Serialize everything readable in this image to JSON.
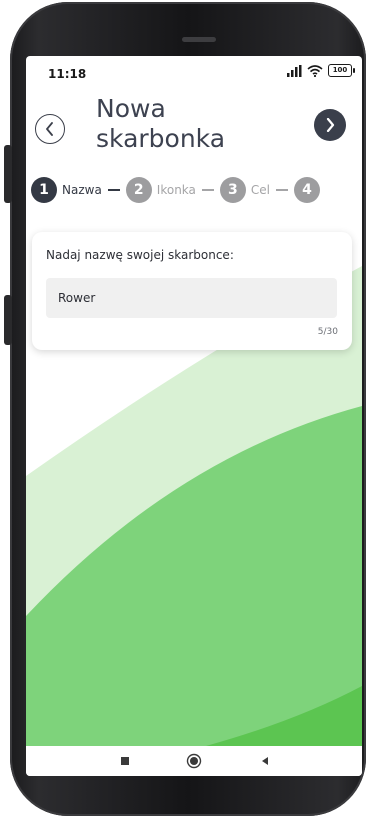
{
  "status": {
    "time": "11:18",
    "battery": "100",
    "icons": [
      "signal-icon",
      "wifi-icon",
      "battery-icon"
    ]
  },
  "header": {
    "title_line1": "Nowa",
    "title_line2": "skarbonka",
    "back_icon": "chevron-left-icon",
    "next_icon": "chevron-right-icon"
  },
  "steps": [
    {
      "number": "1",
      "label": "Nazwa",
      "state": "active"
    },
    {
      "number": "2",
      "label": "Ikonka",
      "state": "inactive"
    },
    {
      "number": "3",
      "label": "Cel",
      "state": "inactive"
    },
    {
      "number": "4",
      "label": "",
      "state": "inactive"
    }
  ],
  "form": {
    "prompt": "Nadaj nazwę swojej skarbonce:",
    "name_value": "Rower",
    "counter": "5/30"
  },
  "navbar": {
    "recents_icon": "square-icon",
    "home_icon": "circle-icon",
    "back_icon": "triangle-back-icon"
  },
  "colors": {
    "primary_dark": "#343944",
    "inactive_gray": "#9d9d9f",
    "green_light": "#d9f1d4",
    "green_mid": "#7ed37b",
    "green_dark": "#5cc551"
  }
}
